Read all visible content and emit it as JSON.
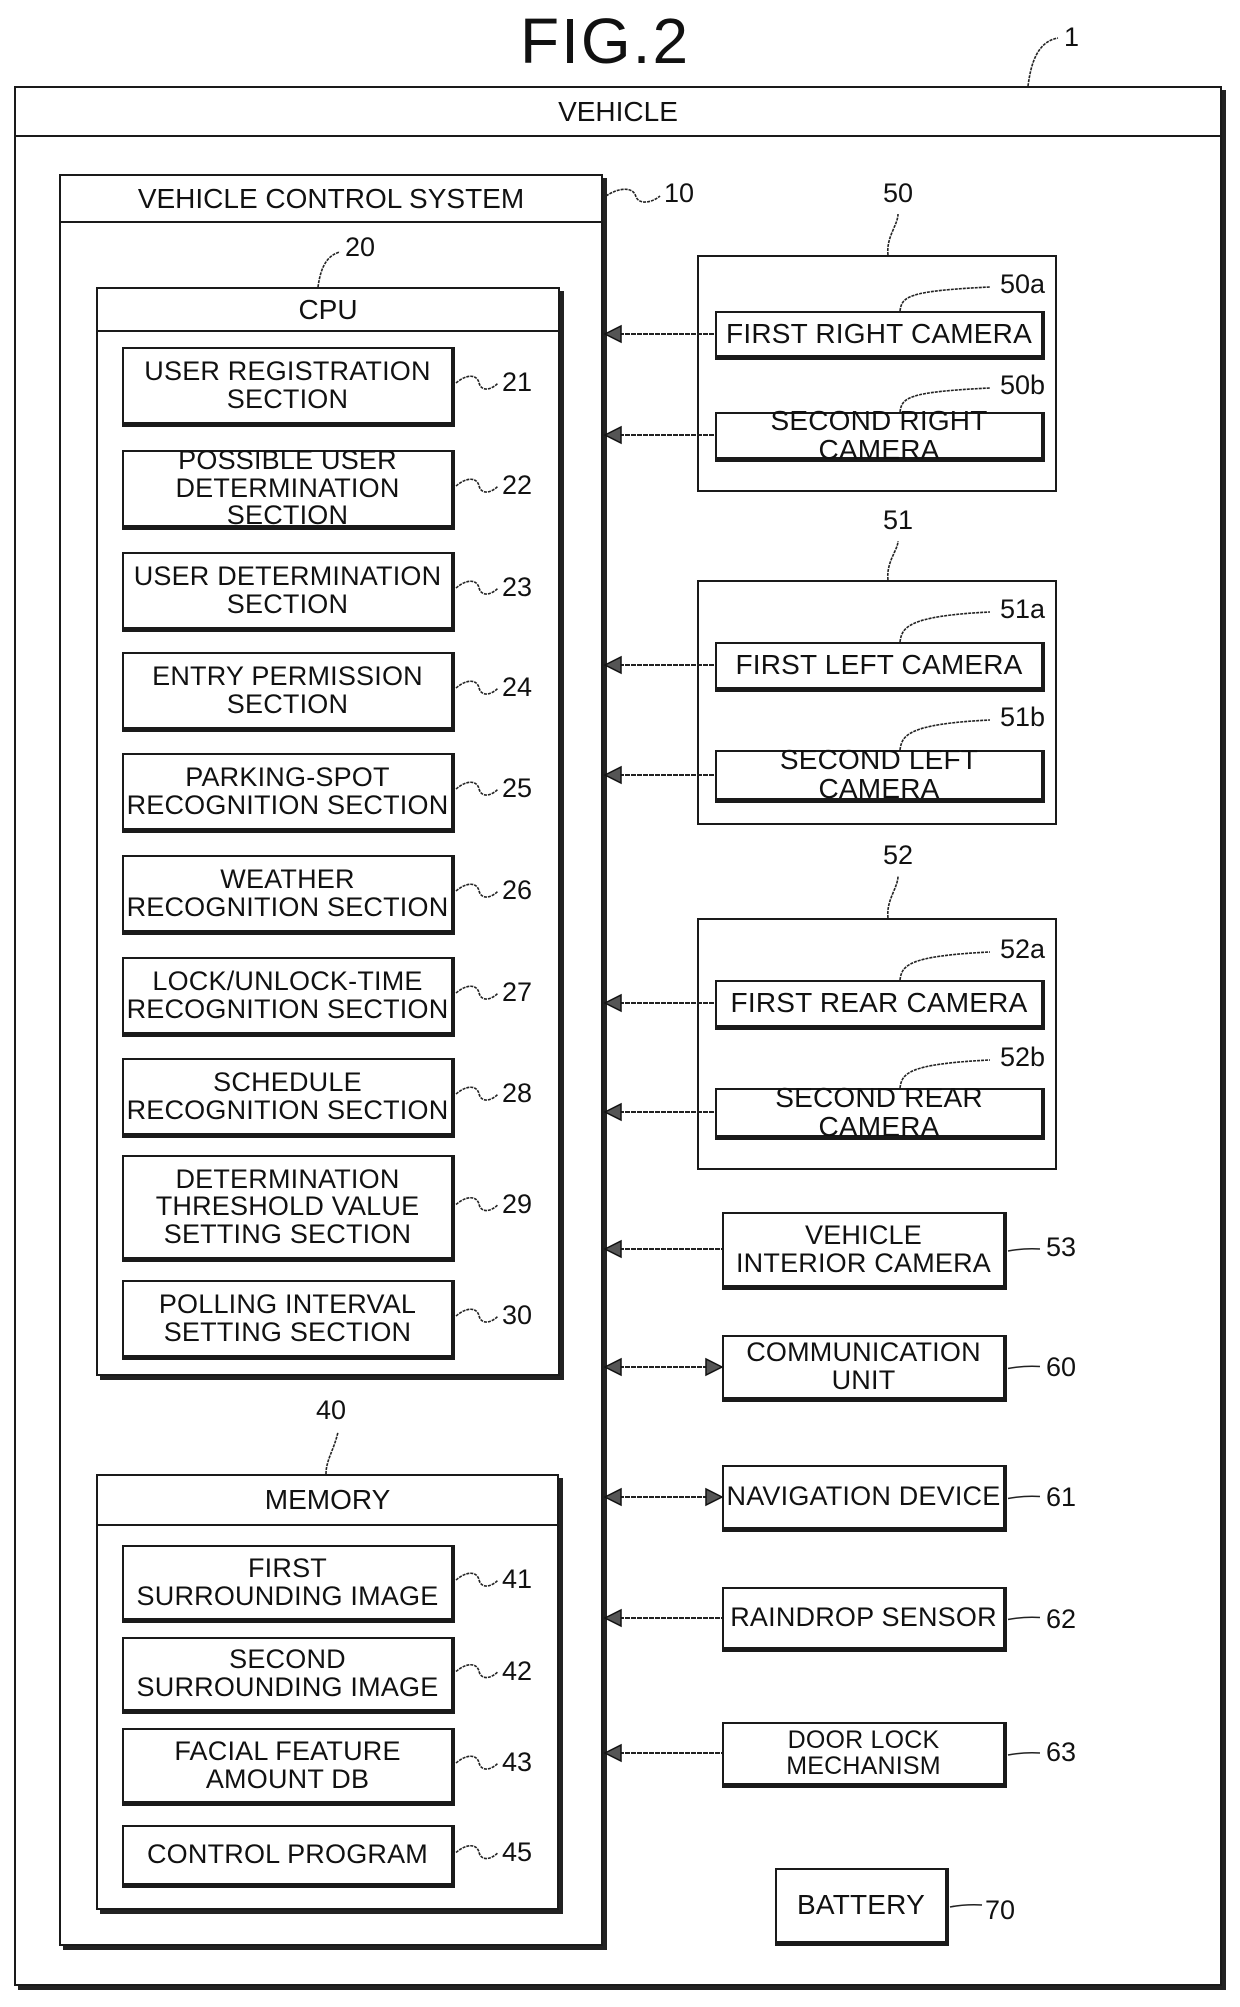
{
  "figure": {
    "title": "FIG.2"
  },
  "vehicle": {
    "label": "VEHICLE",
    "ref": "1"
  },
  "vehicle_control_system": {
    "label": "VEHICLE CONTROL SYSTEM",
    "ref": "10",
    "cpu": {
      "label": "CPU",
      "ref": "20",
      "sections": [
        {
          "label": "USER REGISTRATION\nSECTION",
          "ref": "21"
        },
        {
          "label": "POSSIBLE USER\nDETERMINATION SECTION",
          "ref": "22"
        },
        {
          "label": "USER DETERMINATION\nSECTION",
          "ref": "23"
        },
        {
          "label": "ENTRY PERMISSION\nSECTION",
          "ref": "24"
        },
        {
          "label": "PARKING-SPOT\nRECOGNITION SECTION",
          "ref": "25"
        },
        {
          "label": "WEATHER\nRECOGNITION SECTION",
          "ref": "26"
        },
        {
          "label": "LOCK/UNLOCK-TIME\nRECOGNITION SECTION",
          "ref": "27"
        },
        {
          "label": "SCHEDULE\nRECOGNITION SECTION",
          "ref": "28"
        },
        {
          "label": "DETERMINATION\nTHRESHOLD VALUE\nSETTING SECTION",
          "ref": "29"
        },
        {
          "label": "POLLING INTERVAL\nSETTING SECTION",
          "ref": "30"
        }
      ]
    },
    "memory": {
      "label": "MEMORY",
      "ref": "40",
      "items": [
        {
          "label": "FIRST\nSURROUNDING IMAGE",
          "ref": "41"
        },
        {
          "label": "SECOND\nSURROUNDING IMAGE",
          "ref": "42"
        },
        {
          "label": "FACIAL FEATURE\nAMOUNT DB",
          "ref": "43"
        },
        {
          "label": "CONTROL PROGRAM",
          "ref": "45"
        }
      ]
    }
  },
  "camera_groups": [
    {
      "ref": "50",
      "cameras": [
        {
          "label": "FIRST RIGHT CAMERA",
          "ref": "50a"
        },
        {
          "label": "SECOND RIGHT CAMERA",
          "ref": "50b"
        }
      ]
    },
    {
      "ref": "51",
      "cameras": [
        {
          "label": "FIRST LEFT CAMERA",
          "ref": "51a"
        },
        {
          "label": "SECOND LEFT CAMERA",
          "ref": "51b"
        }
      ]
    },
    {
      "ref": "52",
      "cameras": [
        {
          "label": "FIRST REAR CAMERA",
          "ref": "52a"
        },
        {
          "label": "SECOND REAR CAMERA",
          "ref": "52b"
        }
      ]
    }
  ],
  "peripherals": [
    {
      "label": "VEHICLE\nINTERIOR CAMERA",
      "ref": "53",
      "direction": "to-system"
    },
    {
      "label": "COMMUNICATION UNIT",
      "ref": "60",
      "direction": "bidirectional"
    },
    {
      "label": "NAVIGATION DEVICE",
      "ref": "61",
      "direction": "bidirectional"
    },
    {
      "label": "RAINDROP SENSOR",
      "ref": "62",
      "direction": "to-system"
    },
    {
      "label": "DOOR LOCK MECHANISM",
      "ref": "63",
      "direction": "to-system"
    }
  ],
  "battery": {
    "label": "BATTERY",
    "ref": "70"
  }
}
